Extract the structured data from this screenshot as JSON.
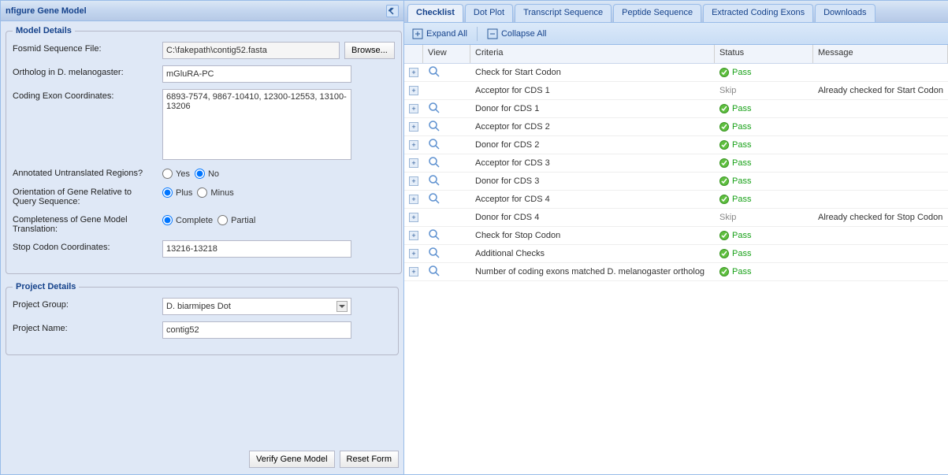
{
  "left_panel": {
    "title": "nfigure Gene Model",
    "model_details_legend": "Model Details",
    "rows": {
      "fosmid_label": "Fosmid Sequence File:",
      "fosmid_value": "C:\\fakepath\\contig52.fasta",
      "browse_label": "Browse...",
      "ortholog_label": "Ortholog in D. melanogaster:",
      "ortholog_value": "mGluRA-PC",
      "coding_label": "Coding Exon Coordinates:",
      "coding_value": "6893-7574, 9867-10410, 12300-12553, 13100-13206",
      "annot_label": "Annotated Untranslated Regions?",
      "annot_yes": "Yes",
      "annot_no": "No",
      "orient_label": "Orientation of Gene Relative to Query Sequence:",
      "orient_plus": "Plus",
      "orient_minus": "Minus",
      "complete_label": "Completeness of Gene Model Translation:",
      "complete_complete": "Complete",
      "complete_partial": "Partial",
      "stop_label": "Stop Codon Coordinates:",
      "stop_value": "13216-13218"
    },
    "project_details_legend": "Project Details",
    "project": {
      "group_label": "Project Group:",
      "group_value": "D. biarmipes Dot",
      "name_label": "Project Name:",
      "name_value": "contig52"
    },
    "buttons": {
      "verify": "Verify Gene Model",
      "reset": "Reset Form"
    }
  },
  "tabs": [
    {
      "label": "Checklist",
      "active": true
    },
    {
      "label": "Dot Plot",
      "active": false
    },
    {
      "label": "Transcript Sequence",
      "active": false
    },
    {
      "label": "Peptide Sequence",
      "active": false
    },
    {
      "label": "Extracted Coding Exons",
      "active": false
    },
    {
      "label": "Downloads",
      "active": false
    }
  ],
  "toolbar": {
    "expand_all": "Expand All",
    "collapse_all": "Collapse All"
  },
  "grid": {
    "headers": {
      "view": "View",
      "criteria": "Criteria",
      "status": "Status",
      "message": "Message"
    },
    "rows": [
      {
        "view": true,
        "criteria": "Check for Start Codon",
        "status": "Pass",
        "message": ""
      },
      {
        "view": false,
        "criteria": "Acceptor for CDS 1",
        "status": "Skip",
        "message": "Already checked for Start Codon"
      },
      {
        "view": true,
        "criteria": "Donor for CDS 1",
        "status": "Pass",
        "message": ""
      },
      {
        "view": true,
        "criteria": "Acceptor for CDS 2",
        "status": "Pass",
        "message": ""
      },
      {
        "view": true,
        "criteria": "Donor for CDS 2",
        "status": "Pass",
        "message": ""
      },
      {
        "view": true,
        "criteria": "Acceptor for CDS 3",
        "status": "Pass",
        "message": ""
      },
      {
        "view": true,
        "criteria": "Donor for CDS 3",
        "status": "Pass",
        "message": ""
      },
      {
        "view": true,
        "criteria": "Acceptor for CDS 4",
        "status": "Pass",
        "message": ""
      },
      {
        "view": false,
        "criteria": "Donor for CDS 4",
        "status": "Skip",
        "message": "Already checked for Stop Codon"
      },
      {
        "view": true,
        "criteria": "Check for Stop Codon",
        "status": "Pass",
        "message": ""
      },
      {
        "view": true,
        "criteria": "Additional Checks",
        "status": "Pass",
        "message": ""
      },
      {
        "view": true,
        "criteria": "Number of coding exons matched D. melanogaster ortholog",
        "status": "Pass",
        "message": ""
      }
    ]
  }
}
